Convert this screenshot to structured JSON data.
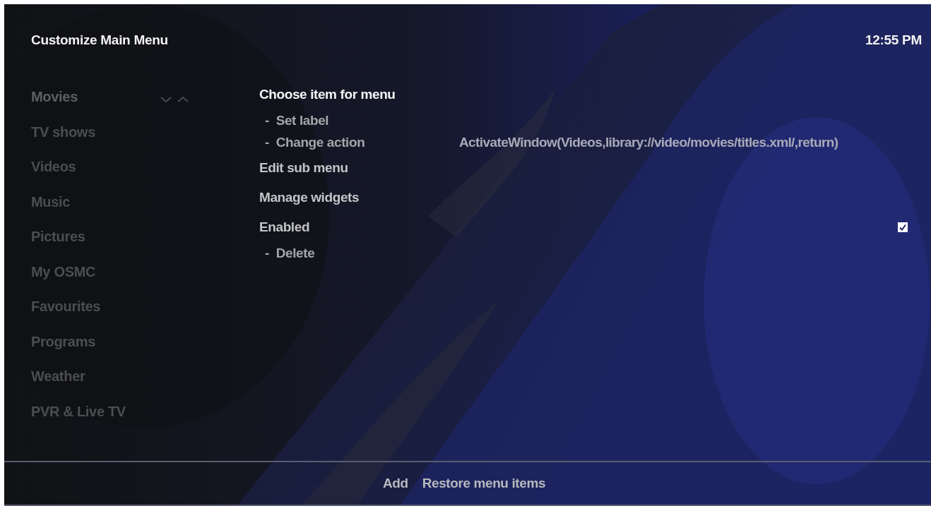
{
  "window": {
    "title": "Customize Main Menu",
    "clock": "12:55 PM"
  },
  "menu_items": [
    {
      "label": "Movies",
      "selected": true
    },
    {
      "label": "TV shows",
      "selected": false
    },
    {
      "label": "Videos",
      "selected": false
    },
    {
      "label": "Music",
      "selected": false
    },
    {
      "label": "Pictures",
      "selected": false
    },
    {
      "label": "My OSMC",
      "selected": false
    },
    {
      "label": "Favourites",
      "selected": false
    },
    {
      "label": "Programs",
      "selected": false
    },
    {
      "label": "Weather",
      "selected": false
    },
    {
      "label": "PVR & Live TV",
      "selected": false
    }
  ],
  "options": [
    {
      "kind": "main",
      "label": "Choose item for menu",
      "selected": true
    },
    {
      "kind": "sub",
      "label": "-  Set label",
      "selected": false
    },
    {
      "kind": "sub",
      "label": "-  Change action",
      "value": "ActivateWindow(Videos,library://video/movies/titles.xml/,return)",
      "selected": false
    },
    {
      "kind": "main",
      "label": "Edit sub menu",
      "selected": false
    },
    {
      "kind": "main",
      "label": "Manage widgets",
      "selected": false
    },
    {
      "kind": "toggle",
      "label": "Enabled",
      "checked": true,
      "selected": false
    },
    {
      "kind": "sub",
      "label": "-  Delete",
      "selected": false
    }
  ],
  "buttons": [
    "Add",
    "Restore menu items"
  ]
}
